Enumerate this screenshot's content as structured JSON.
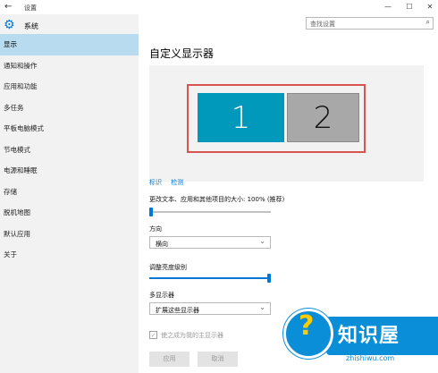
{
  "window": {
    "title": "设置",
    "back_icon": "arrow-left-icon",
    "minimize_label": "—",
    "maximize_label": "☐",
    "close_label": "✕"
  },
  "sidebar": {
    "header_label": "系统",
    "header_icon": "gear-icon",
    "items": [
      {
        "label": "显示",
        "active": true
      },
      {
        "label": "通知和操作"
      },
      {
        "label": "应用和功能"
      },
      {
        "label": "多任务"
      },
      {
        "label": "平板电脑模式"
      },
      {
        "label": "节电模式"
      },
      {
        "label": "电源和睡眠"
      },
      {
        "label": "存储"
      },
      {
        "label": "脱机地图"
      },
      {
        "label": "默认应用"
      },
      {
        "label": "关于"
      }
    ]
  },
  "search": {
    "placeholder": "查找设置",
    "icon": "search-icon"
  },
  "main": {
    "title": "自定义显示器",
    "monitors": [
      {
        "label": "1",
        "selected": true
      },
      {
        "label": "2",
        "selected": false
      }
    ],
    "links": {
      "identify": "标识",
      "detect": "检测"
    },
    "scale_label": "更改文本、应用和其他项目的大小: 100% (推荐)",
    "scale_slider_level": 0.0,
    "orientation_label": "方向",
    "orientation_value": "横向",
    "brightness_label": "调整亮度级别",
    "brightness_slider_level": 1.0,
    "multi_display_label": "多显示器",
    "multi_display_value": "扩展这些显示器",
    "main_display_checkbox_label": "使之成为我的主显示器",
    "main_display_checked": true,
    "apply_button": "应用",
    "cancel_button": "取消"
  },
  "watermark": {
    "text": "知识屋",
    "sub": "zhishiwu.com"
  },
  "colors": {
    "accent": "#0078d7",
    "monitor_selected": "#0099bc",
    "monitor_other": "#a8a8a8",
    "highlight": "#d9534f",
    "sidebar_active": "#b8dbef"
  }
}
